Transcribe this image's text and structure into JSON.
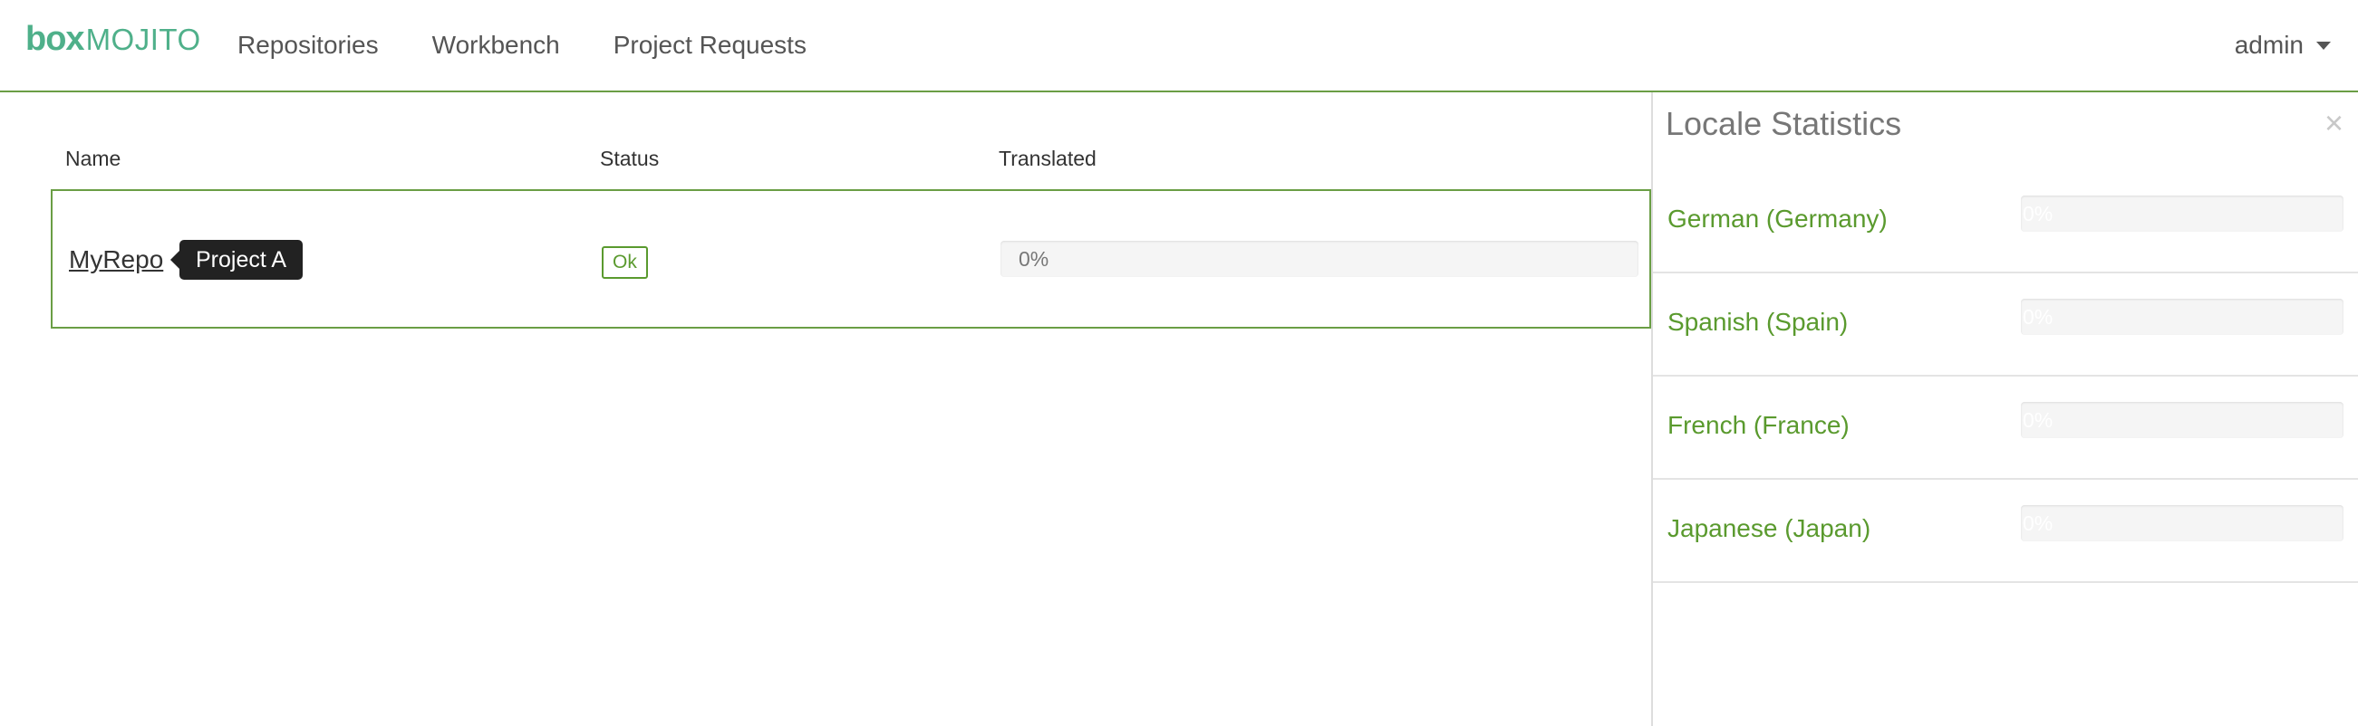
{
  "navbar": {
    "logo_box": "box",
    "logo_mojito": "MOJITO",
    "links": [
      "Repositories",
      "Workbench",
      "Project Requests"
    ],
    "user": "admin"
  },
  "table": {
    "headers": {
      "name": "Name",
      "status": "Status",
      "translated": "Translated"
    },
    "rows": [
      {
        "name": "MyRepo",
        "tooltip": "Project A",
        "status": "Ok",
        "translated_label": "0%",
        "translated_fraction": 0
      }
    ]
  },
  "locale_panel": {
    "title": "Locale Statistics",
    "close": "×",
    "locales": [
      {
        "name": "German (Germany)",
        "progress_label": "0%",
        "progress_fraction": 0
      },
      {
        "name": "Spanish (Spain)",
        "progress_label": "0%",
        "progress_fraction": 0
      },
      {
        "name": "French (France)",
        "progress_label": "0%",
        "progress_fraction": 0
      },
      {
        "name": "Japanese (Japan)",
        "progress_label": "0%",
        "progress_fraction": 0
      }
    ]
  },
  "colors": {
    "brand_green": "#4fb08a",
    "accent_green": "#5a9a2e",
    "border_green": "#6a9e45"
  }
}
